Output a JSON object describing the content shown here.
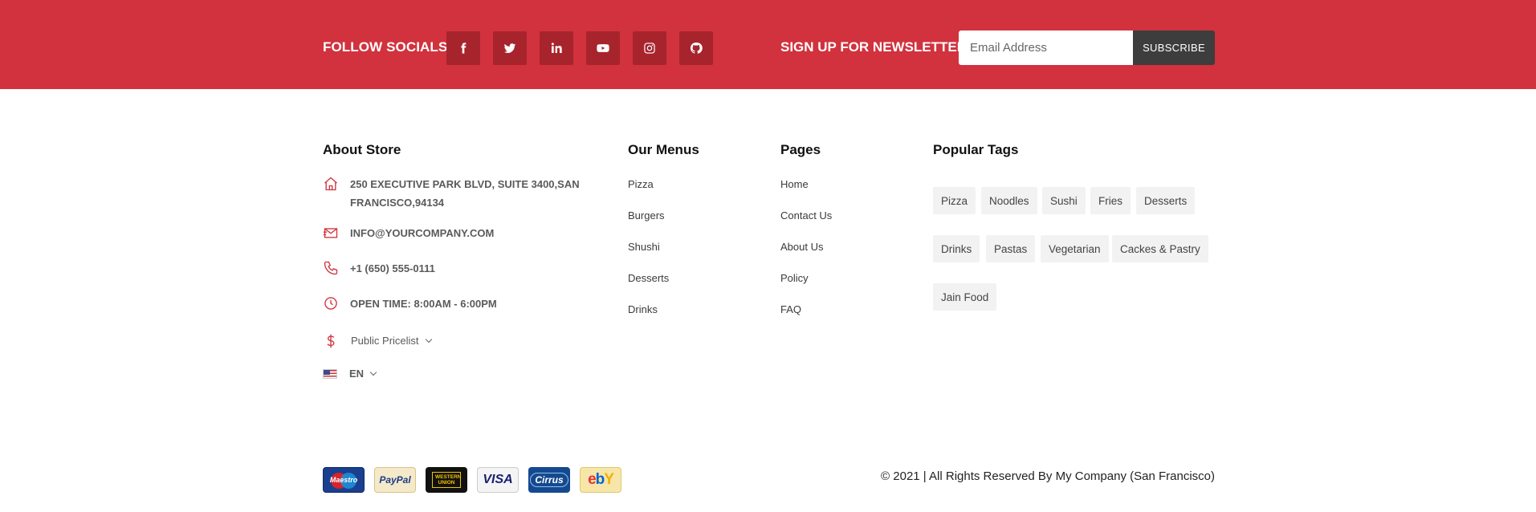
{
  "socials": {
    "label": "FOLLOW SOCIALS",
    "icons": [
      "facebook-icon",
      "twitter-icon",
      "linkedin-icon",
      "youtube-icon",
      "instagram-icon",
      "github-icon"
    ]
  },
  "newsletter": {
    "label": "SIGN UP FOR NEWSLETTER",
    "email_placeholder": "Email Address",
    "email_value": "",
    "subscribe_label": "SUBSCRIBE"
  },
  "about": {
    "title": "About Store",
    "address": "250 EXECUTIVE PARK BLVD, SUITE 3400,SAN FRANCISCO,94134",
    "email": "INFO@YOURCOMPANY.COM",
    "phone": "+1 (650) 555-0111",
    "hours": "OPEN TIME: 8:00AM - 6:00PM",
    "pricelist": "Public Pricelist",
    "language": "EN"
  },
  "menus": {
    "title": "Our Menus",
    "items": [
      "Pizza",
      "Burgers",
      "Shushi",
      "Desserts",
      "Drinks"
    ]
  },
  "pages": {
    "title": "Pages",
    "items": [
      "Home",
      "Contact Us",
      "About Us",
      "Policy",
      "FAQ"
    ]
  },
  "tags": {
    "title": "Popular Tags",
    "items": [
      "Pizza",
      "Noodles",
      "Sushi",
      "Fries",
      "Desserts",
      "Drinks",
      "Pastas",
      "Vegetarian",
      "Cackes & Pastry",
      "Jain Food"
    ]
  },
  "payments": [
    "Maestro",
    "PayPal",
    "WESTERN UNION",
    "VISA",
    "Cirrus",
    "ebY"
  ],
  "copyright": "© 2021 | All Rights Reserved By My Company (San Francisco)",
  "colors": {
    "brand_red": "#d1323d",
    "social_bg": "#a8242d",
    "dark_button": "#3d3d3d"
  }
}
